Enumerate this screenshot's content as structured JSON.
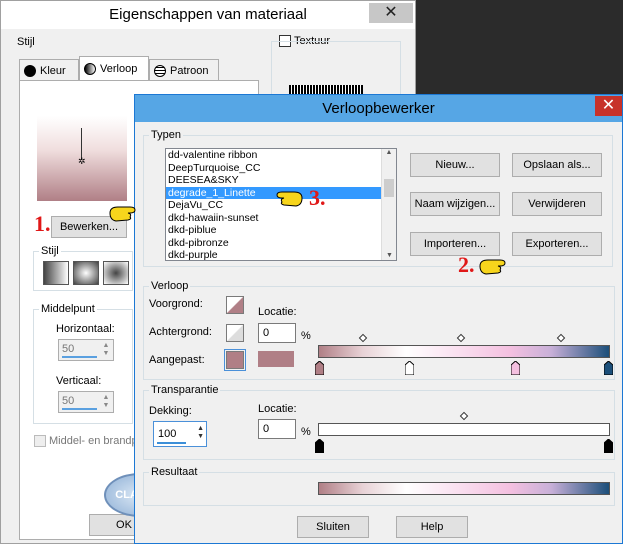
{
  "back_window": {
    "title": "Eigenschappen van materiaal",
    "close_icon": "close-icon",
    "stijl_group": "Stijl",
    "tabs": [
      {
        "label": "Kleur",
        "icon": "circle-filled-icon"
      },
      {
        "label": "Verloop",
        "icon": "gradient-circle-icon"
      },
      {
        "label": "Patroon",
        "icon": "globe-pattern-icon"
      }
    ],
    "texture_label": "Textuur",
    "edit_button": "Bewerken...",
    "style_sub_label": "Stijl",
    "middelpunt_label": "Middelpunt",
    "horizontaal_label": "Horizontaal:",
    "horizontaal_value": "50",
    "verticaal_label": "Verticaal:",
    "verticaal_value": "50",
    "middel_checkbox": "Middel- en brandp",
    "ok_button": "OK",
    "watermark_text": "CLAUDIA"
  },
  "front_window": {
    "title": "Verloopbewerker",
    "close_icon": "close-icon",
    "typen_label": "Typen",
    "gradients": [
      "dd-valentine ribbon",
      "DeepTurquoise_CC",
      "DEESEA&SKY",
      "degrade_1_Linette",
      "DejaVu_CC",
      "dkd-hawaiin-sunset",
      "dkd-piblue",
      "dkd-pibronze",
      "dkd-purple"
    ],
    "selected_index": 3,
    "buttons": {
      "new": "Nieuw...",
      "save_as": "Opslaan als...",
      "rename": "Naam wijzigen...",
      "delete": "Verwijderen",
      "import": "Importeren...",
      "export": "Exporteren..."
    },
    "verloop_label": "Verloop",
    "voorgrond_label": "Voorgrond:",
    "achtergrond_label": "Achtergrond:",
    "aangepast_label": "Aangepast:",
    "locatie_label": "Locatie:",
    "locatie_value": "0",
    "percent": "%",
    "transparantie_label": "Transparantie",
    "dekking_label": "Dekking:",
    "dekking_value": "100",
    "locatie2_label": "Locatie:",
    "locatie2_value": "0",
    "percent2": "%",
    "resultaat_label": "Resultaat",
    "close_button": "Sluiten",
    "help_button": "Help",
    "colors": {
      "mauve": "#b07f86",
      "pink": "#f4c0e0",
      "navy": "#1c4f7a",
      "white": "#ffffff"
    }
  },
  "annotations": {
    "step1": "1.",
    "step2": "2.",
    "step3": "3."
  }
}
